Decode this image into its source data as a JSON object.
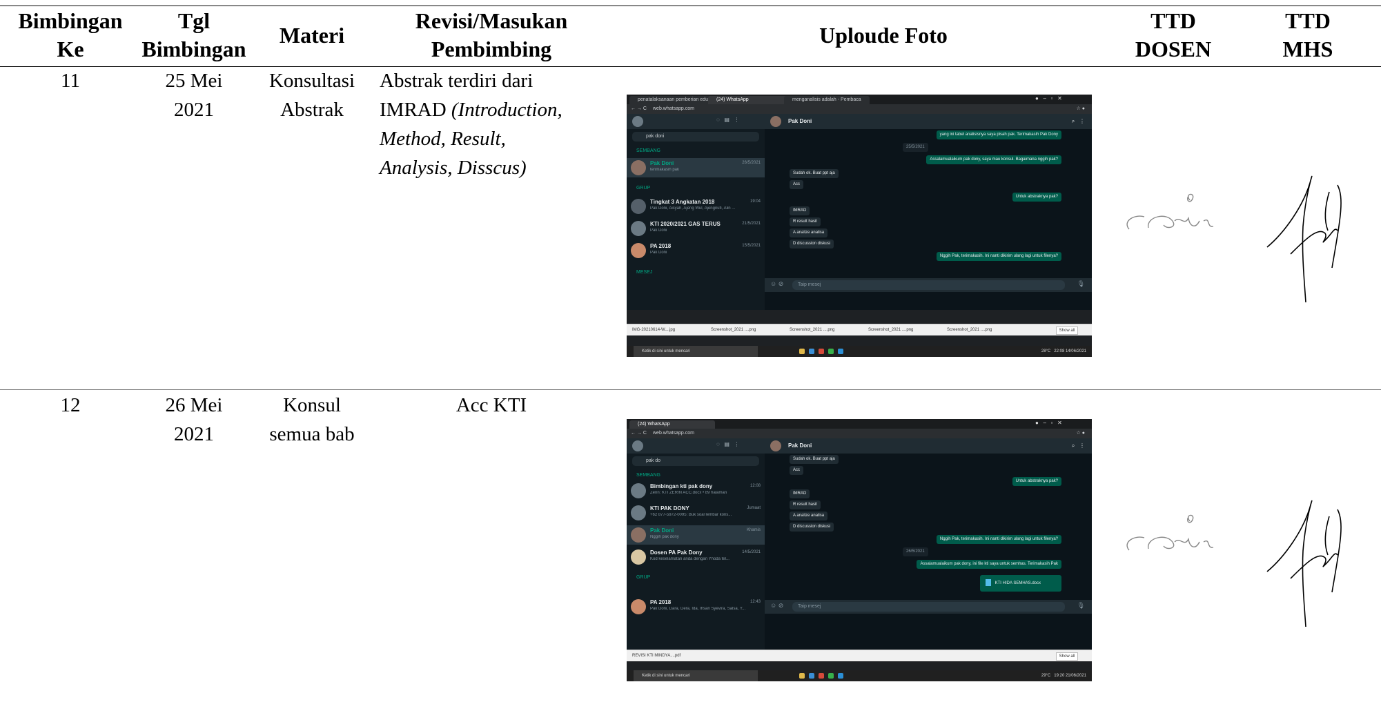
{
  "table": {
    "headers": {
      "bimbingan_ke": "Bimbingan Ke",
      "tgl_bimbingan": "Tgl Bimbingan",
      "materi": "Materi",
      "revisi": "Revisi/Masukan Pembimbing",
      "foto": "Uploude Foto",
      "ttd_dosen": "TTD DOSEN",
      "ttd_mhs": "TTD MHS"
    },
    "headers_lines": {
      "bimbingan_ke": [
        "Bimbingan",
        "Ke"
      ],
      "tgl_bimbingan": [
        "Tgl",
        "Bimbingan"
      ],
      "revisi": [
        "Revisi/Masukan",
        "Pembimbing"
      ],
      "ttd_dosen": [
        "TTD",
        "DOSEN"
      ],
      "ttd_mhs": [
        "TTD",
        "MHS"
      ]
    },
    "rows": [
      {
        "no": "11",
        "tgl_line1": "25 Mei",
        "tgl_line2": "2021",
        "materi_line1": "Konsultasi",
        "materi_line2": "Abstrak",
        "revisi_line1": "Abstrak terdiri dari",
        "revisi_line2_plain": "IMRAD",
        "revisi_line2_italic": "(Introduction,",
        "revisi_line3": "Method, Result,",
        "revisi_line4": "Analysis, Disscus)"
      },
      {
        "no": "12",
        "tgl_line1": "26 Mei",
        "tgl_line2": "2021",
        "materi_line1": "Konsul",
        "materi_line2": "semua bab",
        "revisi_line1": "Acc KTI"
      }
    ]
  },
  "screenshot1": {
    "tabs": [
      "penatalaksanaan pemberian edu",
      "(24) WhatsApp",
      "menganalisis adalah - Pembaca"
    ],
    "url": "web.whatsapp.com",
    "search": "pak doni",
    "section_search": "SEMBANG",
    "section_group": "GRUP",
    "section_msg": "MESEJ",
    "chats": [
      {
        "name": "Pak Doni",
        "preview": "terimakasih pak",
        "time": "26/5/2021",
        "selected": true,
        "green": true
      },
      {
        "name": "Tingkat 3 Angkatan 2018",
        "preview": "Pak Doni, Aisyah, Ajeng Wul, Ajengnufi, Alin ...",
        "time": "19:04"
      },
      {
        "name": "KTI 2020/2021 GAS TERUS",
        "preview": "Pak Doni",
        "time": "21/5/2021"
      },
      {
        "name": "PA 2018",
        "preview": "Pak Doni",
        "time": "15/5/2021"
      }
    ],
    "contact": "Pak Doni",
    "messages": [
      {
        "dir": "out",
        "text": "yang ini tabel analisisnya saya pisah pak. Terimakasih Pak Dony"
      },
      {
        "dir": "date",
        "text": "25/5/2021"
      },
      {
        "dir": "out",
        "text": "Assalamualaikum pak dony, saya mau konsul. Bagaimana nggih pak?"
      },
      {
        "dir": "in",
        "text": "Sudah ok. Buat ppt aja"
      },
      {
        "dir": "in",
        "text": "Acc"
      },
      {
        "dir": "out",
        "text": "Untuk abstraknya pak?"
      },
      {
        "dir": "in",
        "text": "IMRAD"
      },
      {
        "dir": "in",
        "text": "R result hasil"
      },
      {
        "dir": "in",
        "text": "A analize analisa"
      },
      {
        "dir": "in",
        "text": "D discussion diskusi"
      },
      {
        "dir": "out",
        "text": "Nggih Pak, terimakasih. Ini nanti dikirim ulang lagi untuk filenya?"
      }
    ],
    "compose": "Taip mesej",
    "downloads": [
      "IMG-20210614-W....jpg",
      "Screenshot_2021 ....png",
      "Screenshot_2021 ....png",
      "Screenshot_2021 ....png",
      "Screenshot_2021 ....png"
    ],
    "show_all": "Show all",
    "taskbar_search": "Ketik di sini untuk mencari",
    "weather": "28°C",
    "clock_time": "22:08",
    "clock_date": "14/06/2021"
  },
  "screenshot2": {
    "tabs": [
      "(24) WhatsApp"
    ],
    "url": "web.whatsapp.com",
    "search": "pak do",
    "section_search": "SEMBANG",
    "section_group": "GRUP",
    "chats": [
      {
        "name": "Bimbingan kti pak dony",
        "preview": "Zerin: KTI ZERIN ACC.docx • 89 halaman",
        "time": "12:08"
      },
      {
        "name": "KTI PAK DONY",
        "preview": "+62 877-5972-0095: Buk soal lembar kons...",
        "time": "Jumaat"
      },
      {
        "name": "Pak Doni",
        "preview": "Nggih pak dony",
        "time": "Khamis",
        "selected": true,
        "green": true
      },
      {
        "name": "Dosen PA Pak Dony",
        "preview": "Kod keselamatan anda dengan Yhoda tel...",
        "time": "14/5/2021"
      },
      {
        "name": "PA 2018",
        "preview": "Pak Doni, Dara, Dera, Ida, Ihsan Syevira, Salsa, Y...",
        "time": "12:43"
      }
    ],
    "contact": "Pak Doni",
    "messages": [
      {
        "dir": "in",
        "text": "Sudah ok. Buat ppt aja"
      },
      {
        "dir": "in",
        "text": "Acc"
      },
      {
        "dir": "out",
        "text": "Untuk abstraknya pak?"
      },
      {
        "dir": "in",
        "text": "IMRAD"
      },
      {
        "dir": "in",
        "text": "R result hasil"
      },
      {
        "dir": "in",
        "text": "A analize analisa"
      },
      {
        "dir": "in",
        "text": "D discussion diskusi"
      },
      {
        "dir": "out",
        "text": "Nggih Pak, terimakasih. Ini nanti dikirim ulang lagi untuk filenya?"
      },
      {
        "dir": "date",
        "text": "26/5/2021"
      },
      {
        "dir": "out",
        "text": "Assalamualaikum pak dony, ini file kti saya untuk semhas. Terimakasih Pak"
      },
      {
        "dir": "out",
        "text": "KTI HIDA SEMHAS.docx"
      }
    ],
    "compose": "Taip mesej",
    "downloads": [
      "REVISI KTI MINDYA....pdf"
    ],
    "show_all": "Show all",
    "taskbar_search": "Ketik di sini untuk mencari",
    "weather": "29°C",
    "clock_time": "19:20",
    "clock_date": "21/06/2021"
  }
}
